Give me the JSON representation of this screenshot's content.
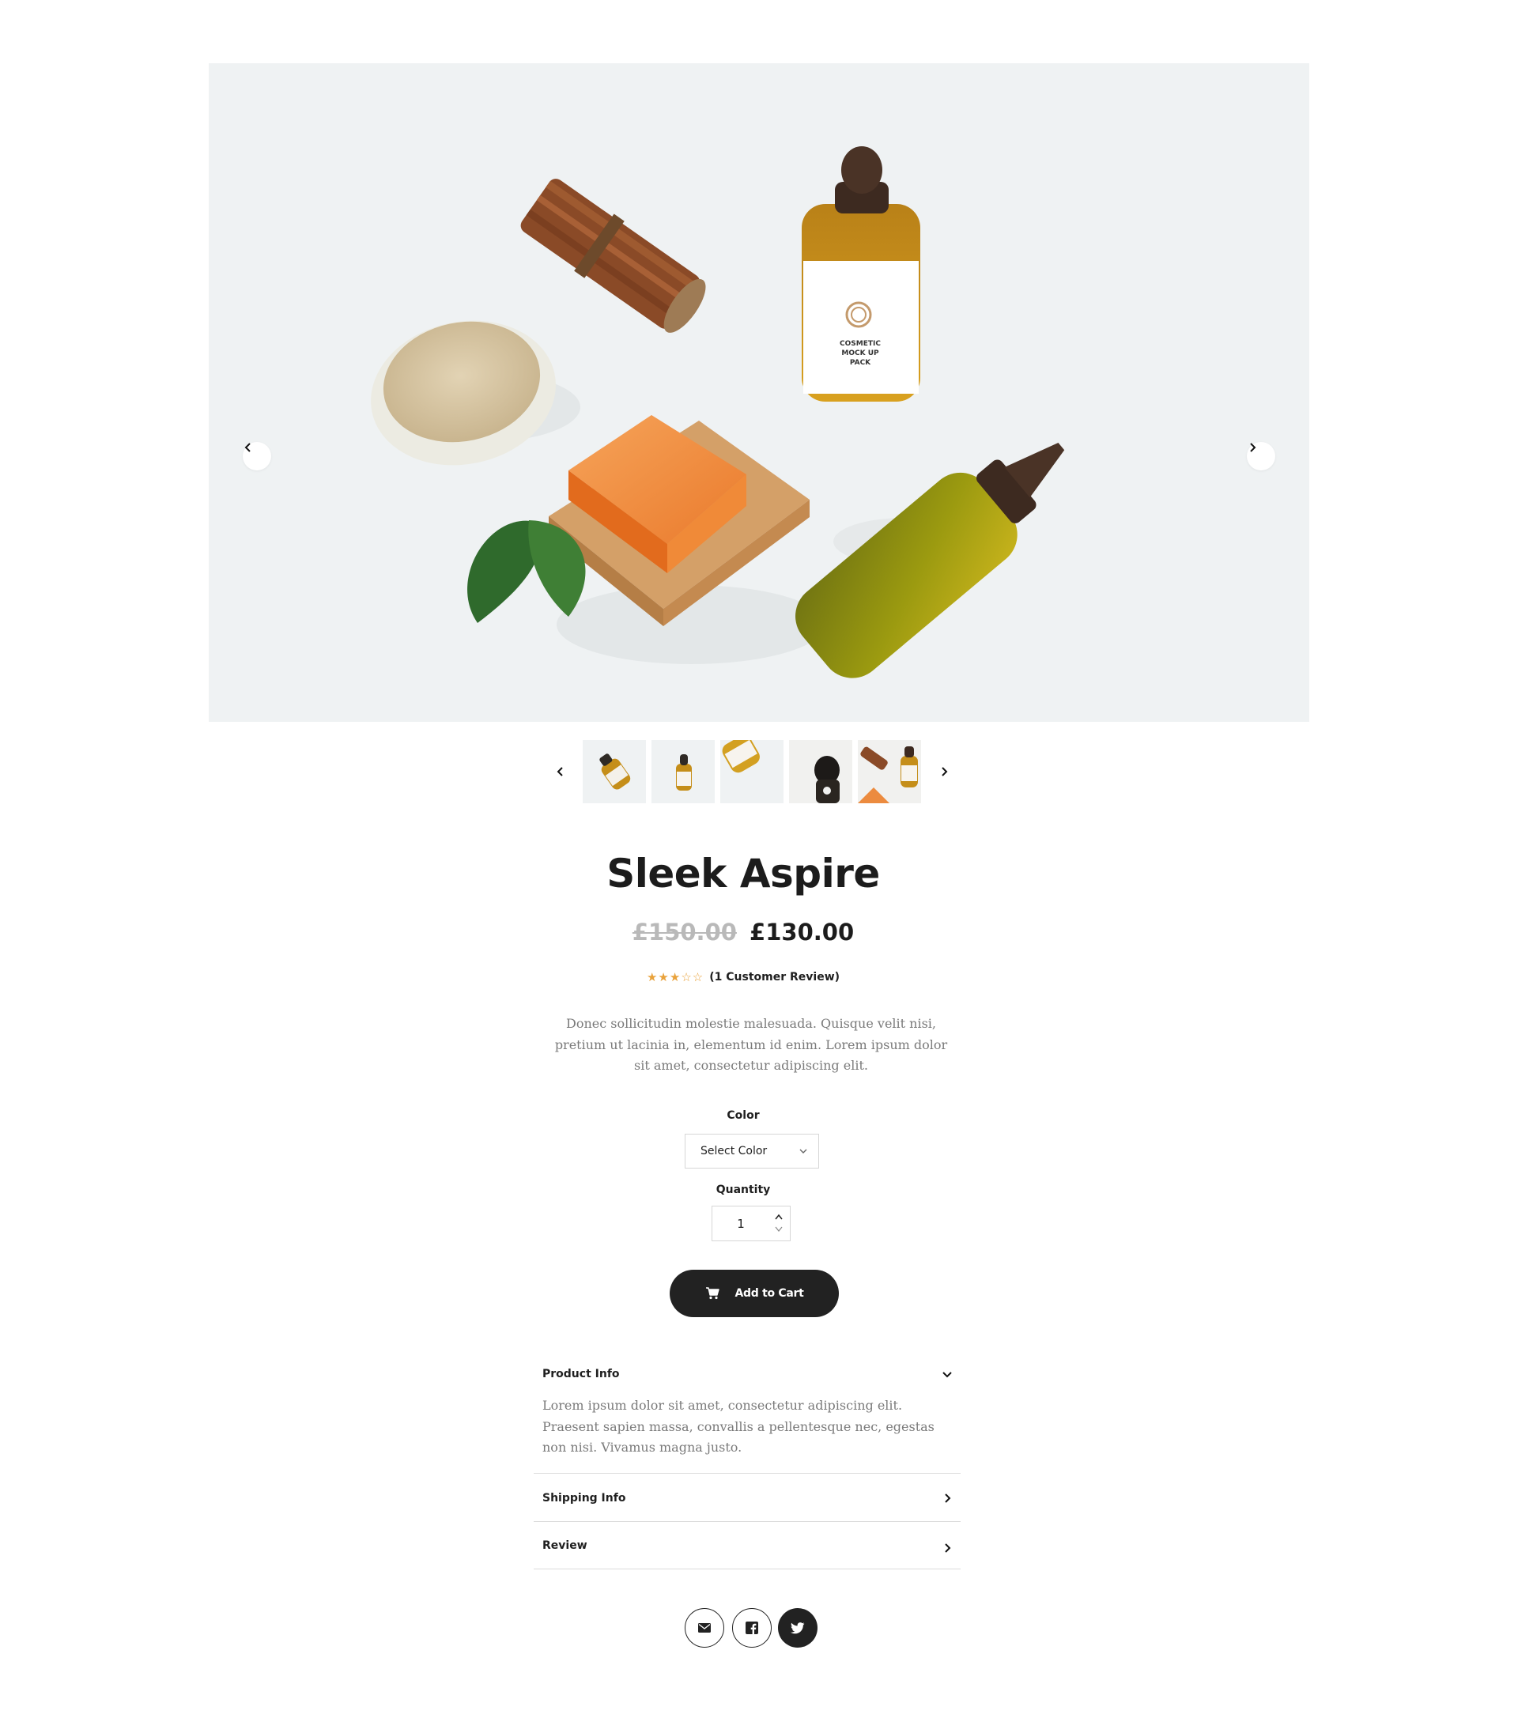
{
  "gallery": {
    "prev_label": "Previous image",
    "next_label": "Next image",
    "label_text": [
      "COSMETIC",
      "MOCK UP",
      "PACK"
    ],
    "thumbnails": [
      "Thumbnail 1",
      "Thumbnail 2",
      "Thumbnail 3",
      "Thumbnail 4",
      "Thumbnail 5"
    ],
    "thumbnails_prev_label": "Previous thumbnails",
    "thumbnails_next_label": "Next thumbnails"
  },
  "product": {
    "title": "Sleek Aspire",
    "old_price": "£150.00",
    "price": "£130.00",
    "rating": 3,
    "rating_max": 5,
    "review_link": "(1 Customer Review)",
    "description": "Donec sollicitudin molestie malesuada. Quisque velit nisi, pretium ut lacinia in, elementum id enim. Lorem ipsum dolor sit amet, consectetur adipiscing elit."
  },
  "options": {
    "color_label": "Color",
    "color_select": "Select Color",
    "quantity_label": "Quantity",
    "quantity_value": "1"
  },
  "cart": {
    "label": "Add to Cart"
  },
  "accordion": [
    {
      "title": "Product Info",
      "expanded": true,
      "body": "Lorem ipsum dolor sit amet, consectetur adipiscing elit. Praesent sapien massa, convallis a pellentesque nec, egestas non nisi. Vivamus magna justo."
    },
    {
      "title": "Shipping Info",
      "expanded": false
    },
    {
      "title": "Review",
      "expanded": false
    }
  ],
  "share": [
    {
      "icon": "envelope-icon"
    },
    {
      "icon": "facebook-icon"
    },
    {
      "icon": "twitter-icon"
    }
  ],
  "colors": {
    "text": "#1f1f1f",
    "muted": "#7a7a7a",
    "old_price": "#b9b9b9",
    "star": "#e9a23b",
    "button": "#222222",
    "image_bg": "#eff2f3"
  }
}
